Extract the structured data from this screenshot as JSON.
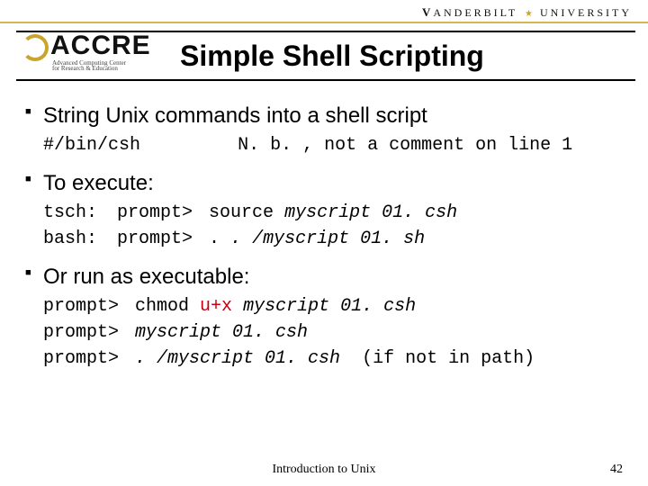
{
  "brand": {
    "vu_v": "V",
    "vu_rest": "ANDERBILT",
    "vu_univ": "UNIVERSITY",
    "accre_big": "ACCRE",
    "accre_sub1": "Advanced Computing Center",
    "accre_sub2": "for Research & Education"
  },
  "title": "Simple Shell Scripting",
  "bullets": {
    "b1": "String Unix commands into a shell script",
    "b1_code": "#/bin/csh",
    "b1_note": "N. b. , not a comment on line 1",
    "b2": "To execute:",
    "tsch_label": "tsch:",
    "tsch_prompt": "prompt>",
    "tsch_cmd": "source",
    "tsch_file": "myscript 01. csh",
    "bash_label": "bash:",
    "bash_prompt": "prompt>",
    "bash_cmd": ".",
    "bash_file": ". /myscript 01. sh",
    "b3": "Or run as executable:",
    "ex1_prompt": "prompt>",
    "ex1_cmd": "chmod",
    "ex1_arg": "u+x",
    "ex1_file": "myscript 01. csh",
    "ex2_prompt": "prompt>",
    "ex2_file": "myscript 01. csh",
    "ex3_prompt": "prompt>",
    "ex3_file": ". /myscript 01. csh",
    "ex3_note": "(if not in path)"
  },
  "footer": {
    "center": "Introduction to Unix",
    "page": "42"
  }
}
